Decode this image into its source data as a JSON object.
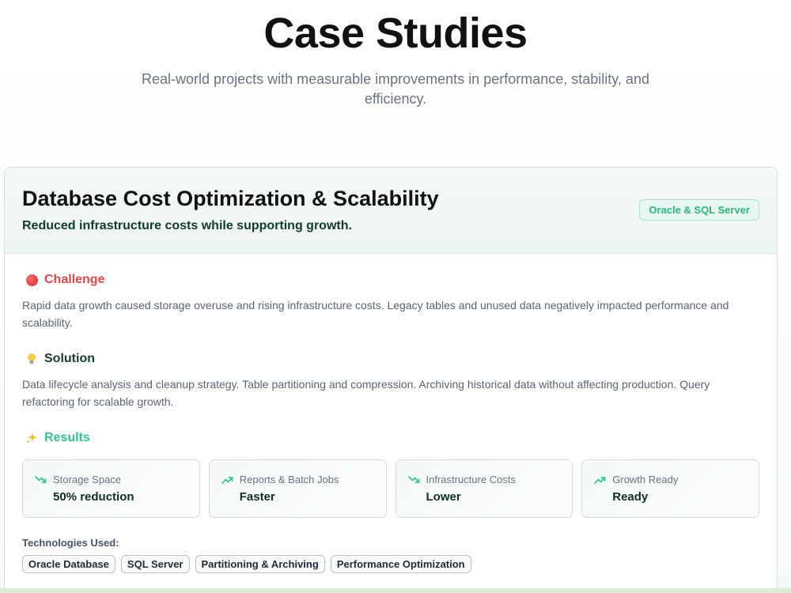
{
  "hero": {
    "title": "Case Studies",
    "subtitle": "Real-world projects with measurable improvements in performance, stability, and efficiency."
  },
  "case_study": {
    "title": "Database Cost Optimization & Scalability",
    "tagline": "Reduced infrastructure costs while supporting growth.",
    "badge": "Oracle & SQL Server",
    "challenge": {
      "icon": "red-circle-icon",
      "label": "Challenge",
      "text": "Rapid data growth caused storage overuse and rising infrastructure costs. Legacy tables and unused data negatively impacted performance and scalability."
    },
    "solution": {
      "icon": "lightbulb-icon",
      "label": "Solution",
      "text": "Data lifecycle analysis and cleanup strategy. Table partitioning and compression. Archiving historical data without affecting production. Query refactoring for scalable growth."
    },
    "results": {
      "icon": "sparkles-icon",
      "label": "Results",
      "metrics": [
        {
          "icon": "trend-down-icon",
          "label": "Storage Space",
          "value": "50% reduction"
        },
        {
          "icon": "trend-up-icon",
          "label": "Reports & Batch Jobs",
          "value": "Faster"
        },
        {
          "icon": "trend-down-icon",
          "label": "Infrastructure Costs",
          "value": "Lower"
        },
        {
          "icon": "trend-up-icon",
          "label": "Growth Ready",
          "value": "Ready"
        }
      ]
    },
    "technologies": {
      "label": "Technologies Used:",
      "items": [
        "Oracle Database",
        "SQL Server",
        "Partitioning & Archiving",
        "Performance Optimization"
      ]
    }
  },
  "colors": {
    "accent_green": "#30c48d",
    "challenge_red": "#e04848",
    "heading_dark": "#111111"
  }
}
